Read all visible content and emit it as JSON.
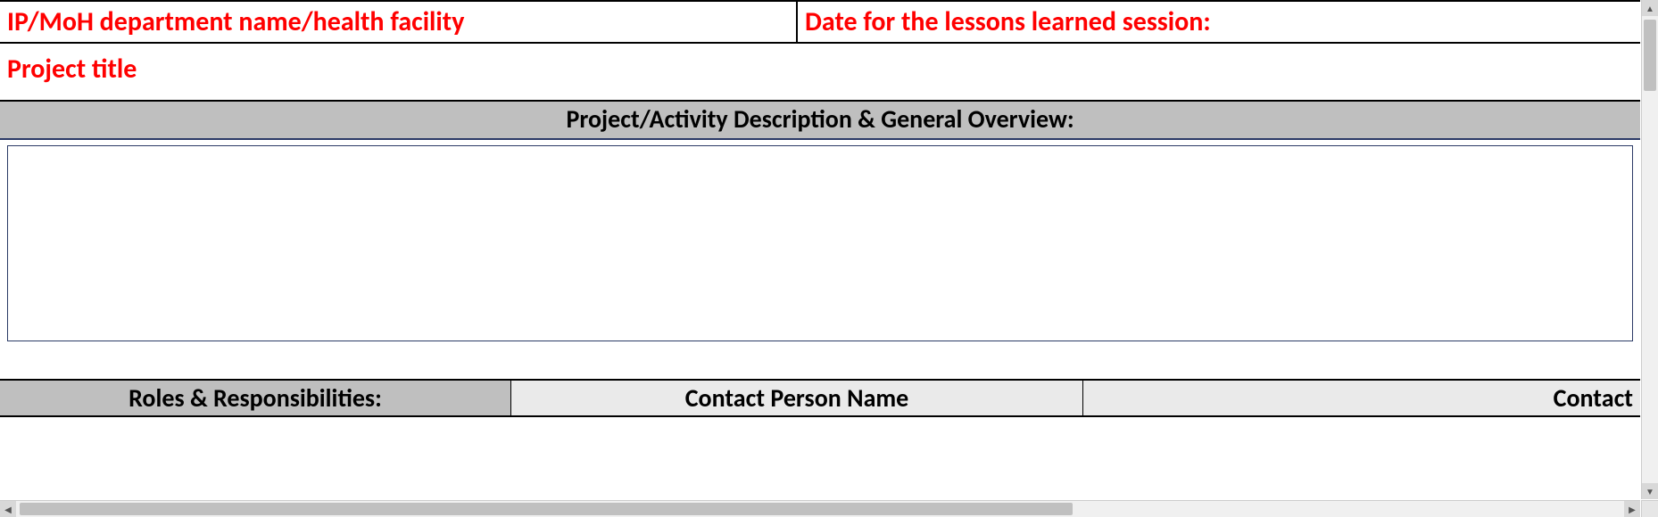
{
  "header": {
    "department_label": "IP/MoH department name/health facility",
    "date_label": "Date for the lessons learned session:"
  },
  "project_title_label": "Project title",
  "section_header": "Project/Activity  Description & General Overview:",
  "description_value": "",
  "columns": {
    "roles": "Roles & Responsibilities:",
    "contact_name": "Contact Person Name",
    "contact_partial": "Contact"
  }
}
